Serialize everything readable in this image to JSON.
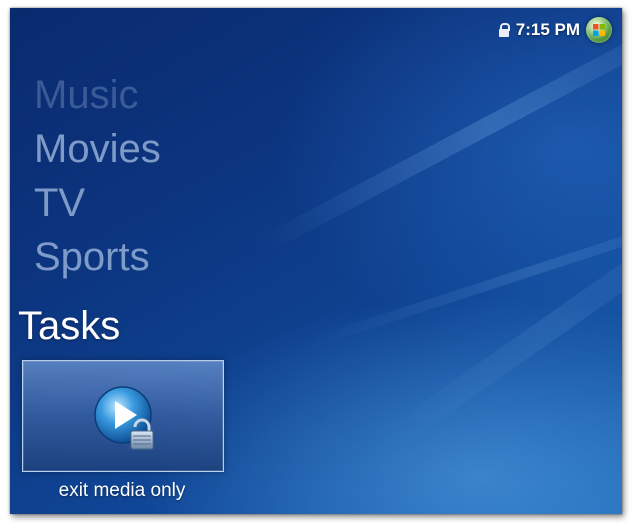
{
  "status": {
    "time": "7:15 PM",
    "lock_icon": "lock-icon",
    "start_icon": "windows-orb-icon"
  },
  "menu": {
    "items": [
      "Music",
      "Movies",
      "TV",
      "Sports"
    ]
  },
  "tasks": {
    "title": "Tasks",
    "tile_label": "exit media only",
    "tile_icon": "play-lock-icon"
  },
  "colors": {
    "background": "#0c3580",
    "accent": "#1a63b4",
    "text": "#ffffff"
  }
}
